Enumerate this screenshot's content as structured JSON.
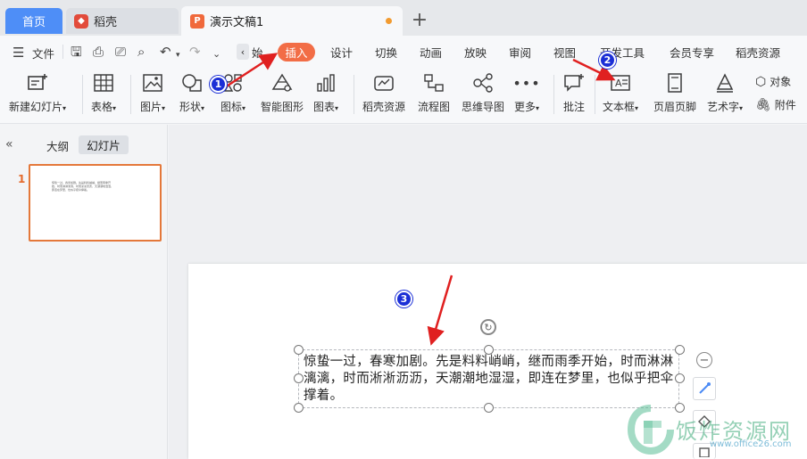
{
  "titlebar": {
    "home_tab": "首页",
    "tabs": [
      {
        "label": "稻壳"
      },
      {
        "label": "演示文稿1"
      }
    ],
    "add_tab": "+"
  },
  "menubar": {
    "file": "文件",
    "partial_start": "始",
    "items": [
      "插入",
      "设计",
      "切换",
      "动画",
      "放映",
      "审阅",
      "视图",
      "开发工具",
      "会员专享",
      "稻壳资源"
    ]
  },
  "ribbon": {
    "buttons": [
      {
        "label": "新建幻灯片",
        "icon": "new-slide-icon",
        "dropdown": true
      },
      {
        "label": "表格",
        "icon": "table-icon",
        "dropdown": true
      },
      {
        "label": "图片",
        "icon": "picture-icon",
        "dropdown": true
      },
      {
        "label": "形状",
        "icon": "shape-icon",
        "dropdown": true
      },
      {
        "label": "图标",
        "icon": "icon-library-icon",
        "dropdown": true
      },
      {
        "label": "智能图形",
        "icon": "smart-graphic-icon",
        "dropdown": false
      },
      {
        "label": "图表",
        "icon": "chart-icon",
        "dropdown": true
      },
      {
        "label": "稻壳资源",
        "icon": "docer-resource-icon",
        "dropdown": false
      },
      {
        "label": "流程图",
        "icon": "flowchart-icon",
        "dropdown": false
      },
      {
        "label": "思维导图",
        "icon": "mindmap-icon",
        "dropdown": false
      },
      {
        "label": "更多",
        "icon": "more-icon",
        "dropdown": true
      },
      {
        "label": "批注",
        "icon": "comment-icon",
        "dropdown": false
      },
      {
        "label": "文本框",
        "icon": "textbox-icon",
        "dropdown": true
      },
      {
        "label": "页眉页脚",
        "icon": "header-footer-icon",
        "dropdown": false
      },
      {
        "label": "艺术字",
        "icon": "wordart-icon",
        "dropdown": true
      }
    ],
    "small": [
      {
        "label": "对象",
        "icon": "object-icon"
      },
      {
        "label": "附件",
        "icon": "attachment-icon"
      }
    ]
  },
  "leftpanel": {
    "outline_tab": "大纲",
    "slides_tab": "幻灯片",
    "slide_number": "1"
  },
  "slide": {
    "text": "惊蛰一过，春寒加剧。先是料料峭峭，继而雨季开始，时而淋淋漓漓，时而淅淅沥沥，天潮潮地湿湿，即连在梦里，也似乎把伞撑着。"
  },
  "annotations": {
    "badge1": "1",
    "badge2": "2",
    "badge3": "3",
    "color": "#e02020"
  },
  "watermark": {
    "title": "饭炸资源网",
    "url": "www.office26.com"
  },
  "colors": {
    "accent": "#4e8ef7",
    "active_menu": "#f26d46",
    "selection": "#e4783a"
  }
}
